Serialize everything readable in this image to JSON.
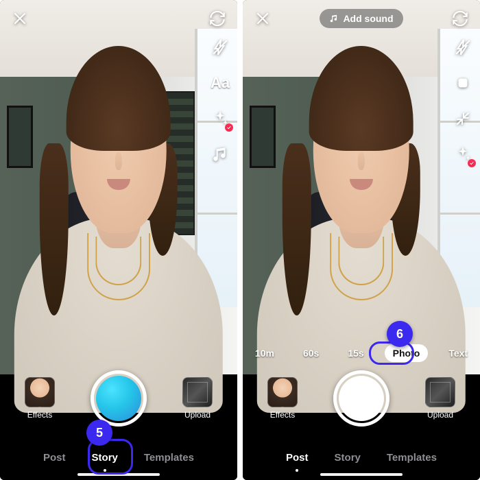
{
  "annotations": {
    "left": "5",
    "right": "6"
  },
  "left": {
    "side_tools": {
      "text_tool_label": "Aa"
    },
    "capture": {
      "effects_label": "Effects",
      "upload_label": "Upload"
    },
    "modes": {
      "post": "Post",
      "story": "Story",
      "templates": "Templates",
      "selected": "story"
    }
  },
  "right": {
    "header": {
      "add_sound": "Add sound"
    },
    "durations": {
      "items": [
        "10m",
        "60s",
        "15s",
        "Photo",
        "Text"
      ],
      "selected_index": 3
    },
    "capture": {
      "effects_label": "Effects",
      "upload_label": "Upload"
    },
    "modes": {
      "post": "Post",
      "story": "Story",
      "templates": "Templates",
      "selected": "post"
    }
  }
}
